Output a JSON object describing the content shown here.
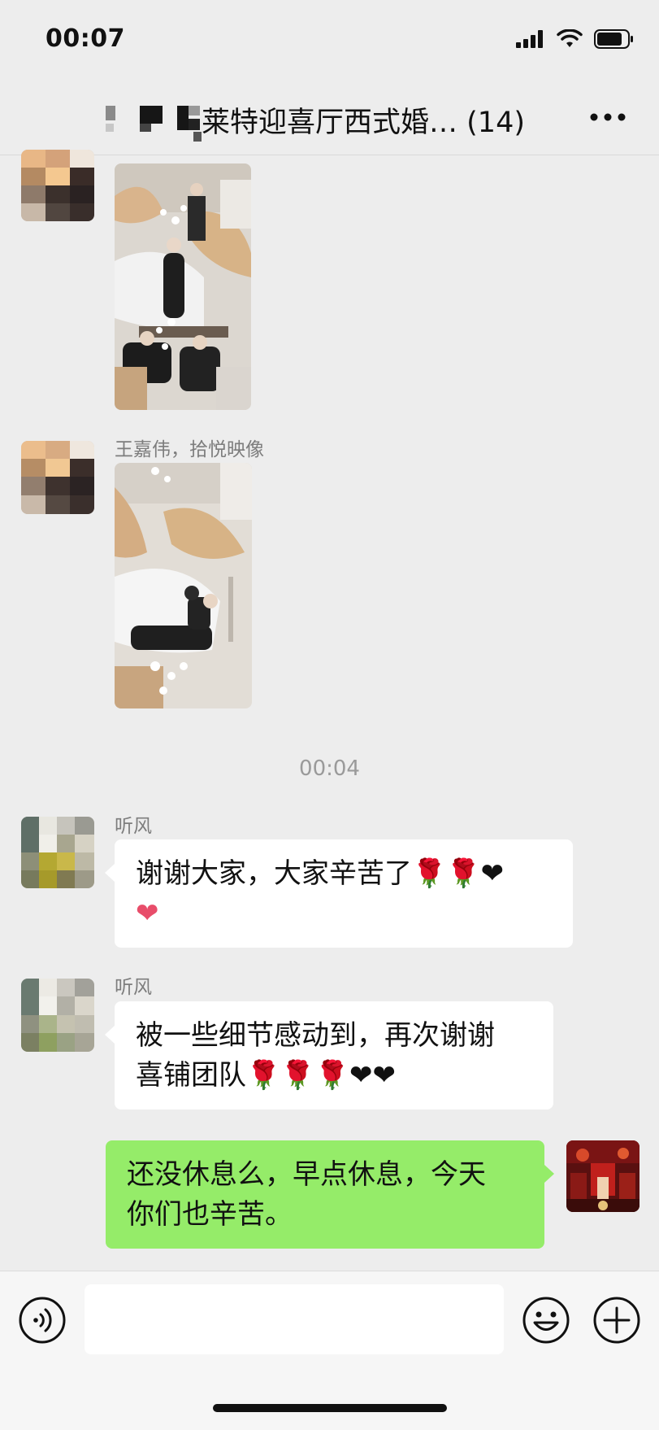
{
  "status_bar": {
    "time": "00:07"
  },
  "nav": {
    "title": "莱特迎喜厅西式婚…",
    "member_count": "(14)"
  },
  "messages": [
    {
      "type": "image",
      "side": "left"
    },
    {
      "type": "image",
      "side": "left",
      "sender": "王嘉伟，拾悦映像"
    },
    {
      "type": "time",
      "text": "00:04"
    },
    {
      "type": "text",
      "side": "left",
      "sender": "听风",
      "line1": "谢谢大家，大家辛苦了🌹🌹❤",
      "line2": "❤"
    },
    {
      "type": "text",
      "side": "left",
      "sender": "听风",
      "line1": "被一些细节感动到，再次谢谢",
      "line2": "喜铺团队🌹🌹🌹❤❤"
    },
    {
      "type": "text",
      "side": "right",
      "line1": "还没休息么，早点休息，今天",
      "line2": "你们也辛苦。"
    }
  ],
  "input": {
    "value": ""
  },
  "icons": [
    "signal-icon",
    "wifi-icon",
    "battery-icon",
    "more-icon",
    "voice-icon",
    "emoji-icon",
    "plus-icon"
  ],
  "colors": {
    "background": "#ededed",
    "my_bubble": "#95ec69",
    "their_bubble": "#ffffff"
  }
}
